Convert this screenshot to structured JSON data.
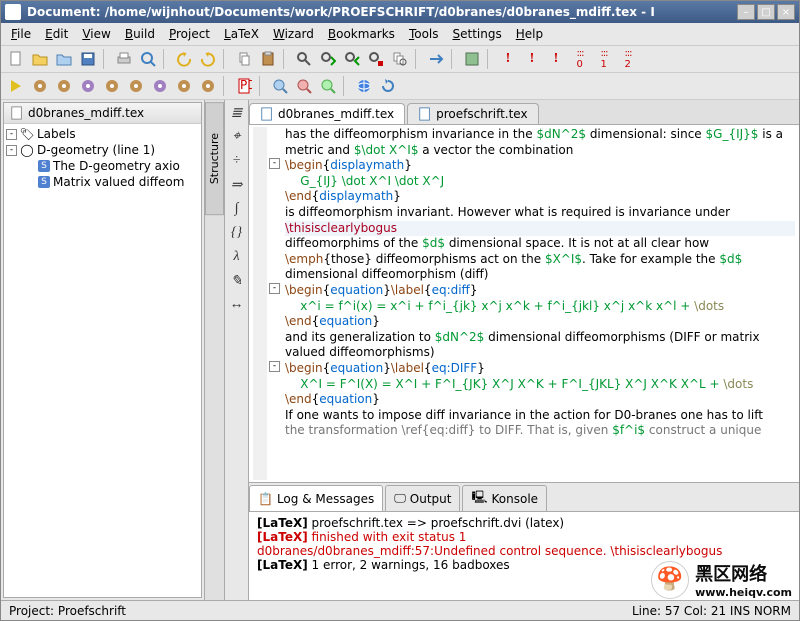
{
  "title": "Document: /home/wijnhout/Documents/work/PROEFSCHRIFT/d0branes/d0branes_mdiff.tex - I",
  "menu": {
    "file": "File",
    "edit": "Edit",
    "view": "View",
    "build": "Build",
    "project": "Project",
    "latex": "LaTeX",
    "wizard": "Wizard",
    "bookmarks": "Bookmarks",
    "tools": "Tools",
    "settings": "Settings",
    "help": "Help"
  },
  "left": {
    "header": "d0branes_mdiff.tex",
    "side_tab": "Structure",
    "tree": [
      {
        "indent": 0,
        "expander": "-",
        "icon": "labels-icon",
        "label": "Labels"
      },
      {
        "indent": 0,
        "expander": "-",
        "icon": "circle-icon",
        "label": "D-geometry (line 1)"
      },
      {
        "indent": 1,
        "expander": "",
        "icon": "section-icon",
        "label": "The D-geometry axio"
      },
      {
        "indent": 1,
        "expander": "",
        "icon": "section-icon",
        "label": "Matrix valued diffeom"
      }
    ]
  },
  "editor": {
    "tabs": [
      {
        "label": "d0branes_mdiff.tex",
        "active": true
      },
      {
        "label": "proefschrift.tex",
        "active": false
      }
    ],
    "tools": [
      "≣",
      "⌖",
      "÷",
      "⇒",
      "∫",
      "{}",
      "λ",
      "✎",
      "↔"
    ]
  },
  "bottom": {
    "tabs": [
      {
        "label": "Log & Messages",
        "active": true
      },
      {
        "label": "Output",
        "active": false
      },
      {
        "label": "Konsole",
        "active": false
      }
    ],
    "lines": {
      "l1_tag": "[LaTeX]",
      "l1_txt": " proefschrift.tex => proefschrift.dvi (latex)",
      "l2_tag": "[LaTeX]",
      "l2_txt": " finished with exit status 1",
      "l3_txt": "d0branes/d0branes_mdiff:57:Undefined control sequence. \\thisisclearlybogus",
      "l4_tag": "[LaTeX]",
      "l4_txt": " 1 error, 2 warnings, 16 badboxes"
    }
  },
  "status": {
    "left": "Project: Proefschrift",
    "right": "Line: 57 Col: 21  INS  NORM"
  },
  "watermark": {
    "name": "黑区网络",
    "url": "www.heiqv.com"
  }
}
